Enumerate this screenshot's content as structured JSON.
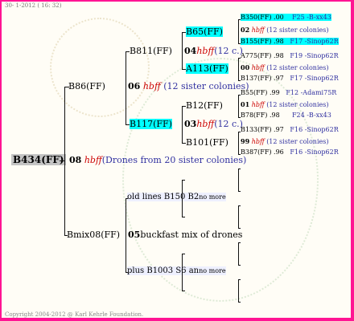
{
  "header": {
    "date": "30-  1-2012 ( 16: 32)"
  },
  "footer": {
    "copyright": "Copyright 2004-2012 @ Karl Kehrle Foundation."
  },
  "tree": {
    "root": "B434(FF)",
    "root_num": "08",
    "root_hbff": "hbff",
    "root_note": "(Drones from 20 sister colonies)",
    "b86": "B86(FF)",
    "b86_num": "06",
    "b86_hbff": "hbff",
    "b86_note": "(12 sister colonies)",
    "b811": "B811(FF)",
    "b811_num": "04",
    "b811_hbff": "hbff",
    "b811_note": "(12 c.)",
    "b65": "B65(FF)",
    "a113": "A113(FF)",
    "b117": "B117(FF)",
    "b117_num": "03",
    "b117_hbff": "hbff",
    "b117_note": "(12 c.)",
    "b12": "B12(FF)",
    "b101": "B101(FF)",
    "bmix": "Bmix08(FF)",
    "bmix_num": "05",
    "bmix_note": "buckfast mix of drones",
    "oldlines": "old lines B150 B2",
    "oldlines_more": "no more",
    "plus": "plus B1003 S6 an",
    "plus_more": "no more"
  },
  "gen4": [
    {
      "name": "B350(FF)",
      "val": ".00",
      "ref": "F25 -B-xx43"
    },
    {
      "num": "02",
      "hbff": "hbff",
      "note": "(12 sister colonies)"
    },
    {
      "name": "B155(FF)",
      "val": ".98",
      "ref": "F17 -Sinop62R"
    },
    {
      "name": "A775(FF)",
      "val": ".98",
      "ref": "F19 -Sinop62R"
    },
    {
      "num": "00",
      "hbff": "hbff",
      "note": "(12 sister colonies)"
    },
    {
      "name": "B137(FF)",
      "val": ".97",
      "ref": "F17 -Sinop62R"
    },
    {
      "name": "B55(FF)",
      "val": ".99",
      "ref": "F12 -Adami75R"
    },
    {
      "num": "01",
      "hbff": "hbff",
      "note": "(12 sister colonies)"
    },
    {
      "name": "B78(FF)",
      "val": ".98",
      "ref": "F24 -B-xx43"
    },
    {
      "name": "B133(FF)",
      "val": ".97",
      "ref": "F16 -Sinop62R"
    },
    {
      "num": "99",
      "hbff": "hbff",
      "note": "(12 sister colonies)"
    },
    {
      "name": "B387(FF)",
      "val": ".96",
      "ref": "F16 -Sinop62R"
    }
  ],
  "colors": {
    "border": "#ff1493",
    "highlight": "#00ffff",
    "hbff": "#cc0000",
    "note": "#3030a0"
  }
}
